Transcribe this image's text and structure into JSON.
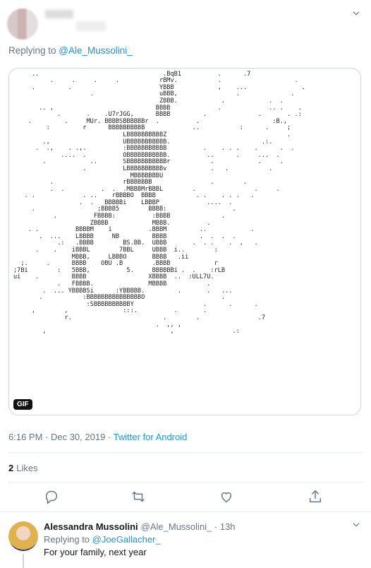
{
  "tweet": {
    "replying_prefix": "Replying to ",
    "replying_handle": "@Ale_Mussolini_",
    "media_badge": "GIF",
    "ascii_art": ".                          .             NBBBr                          \n     ..                                  .BqB1          .      .7        \n          .     .     .     .           rBMv.           .                    .\n     .         .                        YBBB            ,    ...               .\n                     .                  uBBB,                .              .\n                                        ZBBB.            .            .  .     \n       .. ,                            BBBB             .             .. .    .\n            .       .    .U7rJGG,      BBBB         .              .       . .:\n    .         .     MUr. BBBBSBBBBBBr  .          .                    :B.,\n         :         r      BBBBBBBBBB             ..           :      .     ;\n                              LBBBBBBBBBBZ                                 .\n        .,                    UBBBBBBBBBBB.                         .:.\n      .  .,    . .,.          :BBBBBBBBBBB          .    . . .    .      .  .\n             ....  .          OBBBBBBBBBBB.          ..      .     ...  .\n        .            ..       SBBBBBBBBBBBr           .            .     .\n                   .          LBBBBBBBBBBv            .   .           .\n                                MBBBBBBBU\n          .                   rBBBBBBB                .        .\n          .  .          .  .  .MBBBMrBBBL        .                .     .\n   . .             . ..    rBBBBO  BBBB           . .    . . .   .\n                  .  .   BBBBBi    LBBBP             ....  .\n     .                 ;BBBB5        BBBB:                  .\n           .          FBBBB:          :BBBB              .\n                     ZBBBB            MBBB.          .\n    . .          BBBBM    i          .BBBM         ..            .\n       .  ...    LBBBB     NB         BBBB         .  .  .  .\n            .:   .BBBB        BS.BB.  UBBB       .  . .    .  ,   .\n      .    .    iBBBL        7BBL     UBBB  i..        :\n                MBBB,     LBBBO       BBBB   .ii\n  ;.     .      BBBB    OBU .B        .BBBB            r\n;7Bi        :   5BBB,          5.     BBBBBBi .  .    :rLB\nui    .         BBBB                 XBBBB  ..  :ULL7U.\n            .   FBBBB.               MBBBB           .\n        .  ... YBBBBSi      :YBBBBB.         .       .   ...  \n       .           :BBBBBBBBBBBBBBBO                     .\n                    :SBBBBBBBBBBY                   .      .      .\n     ,        ,               :::.          .       .\n              r.                         .        .                .7\n                                       .  ,, ,\n        ,                                  ,                .:",
    "timestamp": "6:16 PM · Dec 30, 2019 · ",
    "source": "Twitter for Android",
    "likes_count": "2",
    "likes_label": "Likes"
  },
  "reply": {
    "name": "Alessandra Mussolini",
    "handle_time": "@Ale_Mussolini_ · 13h",
    "replying_prefix": "Replying to ",
    "replying_handle": "@JoeGallacher_",
    "text": "For your family, next year"
  },
  "colors": {
    "accent": "#1b95e0",
    "muted": "#657786",
    "divider": "#e6ecf0"
  },
  "icons": [
    "chevron-down-icon",
    "reply-icon",
    "retweet-icon",
    "like-icon",
    "share-icon"
  ]
}
